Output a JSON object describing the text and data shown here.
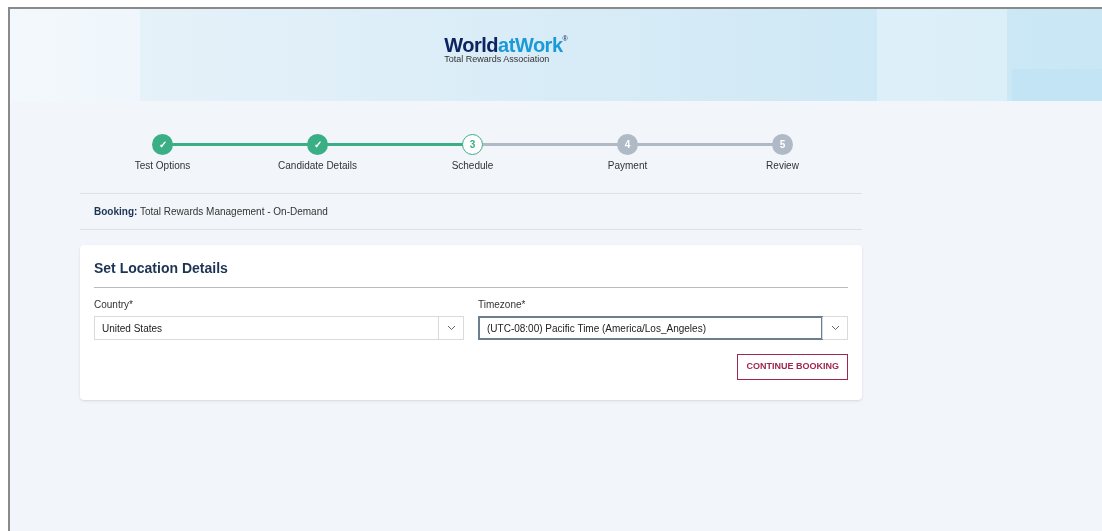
{
  "logo": {
    "parts": [
      {
        "text": "World",
        "color": "#0c2461"
      },
      {
        "text": "at",
        "color": "#1a9ad6"
      },
      {
        "text": "Work",
        "color": "#1a9ad6"
      }
    ],
    "mark": "®",
    "tagline": "Total Rewards Association"
  },
  "steps": [
    {
      "label": "Test Options",
      "kind": "done",
      "glyph": "✓"
    },
    {
      "label": "Candidate Details",
      "kind": "done",
      "glyph": "✓"
    },
    {
      "label": "Schedule",
      "kind": "current",
      "glyph": "3"
    },
    {
      "label": "Payment",
      "kind": "upcoming",
      "glyph": "4"
    },
    {
      "label": "Review",
      "kind": "upcoming",
      "glyph": "5"
    }
  ],
  "booking": {
    "label": "Booking:",
    "value": "Total Rewards Management - On-Demand"
  },
  "card": {
    "title": "Set Location Details",
    "fields": [
      {
        "label": "Country*",
        "value": "United States",
        "focused": false
      },
      {
        "label": "Timezone*",
        "value": "(UTC-08:00) Pacific Time (America/Los_Angeles)",
        "focused": true
      }
    ],
    "button": "CONTINUE BOOKING"
  }
}
